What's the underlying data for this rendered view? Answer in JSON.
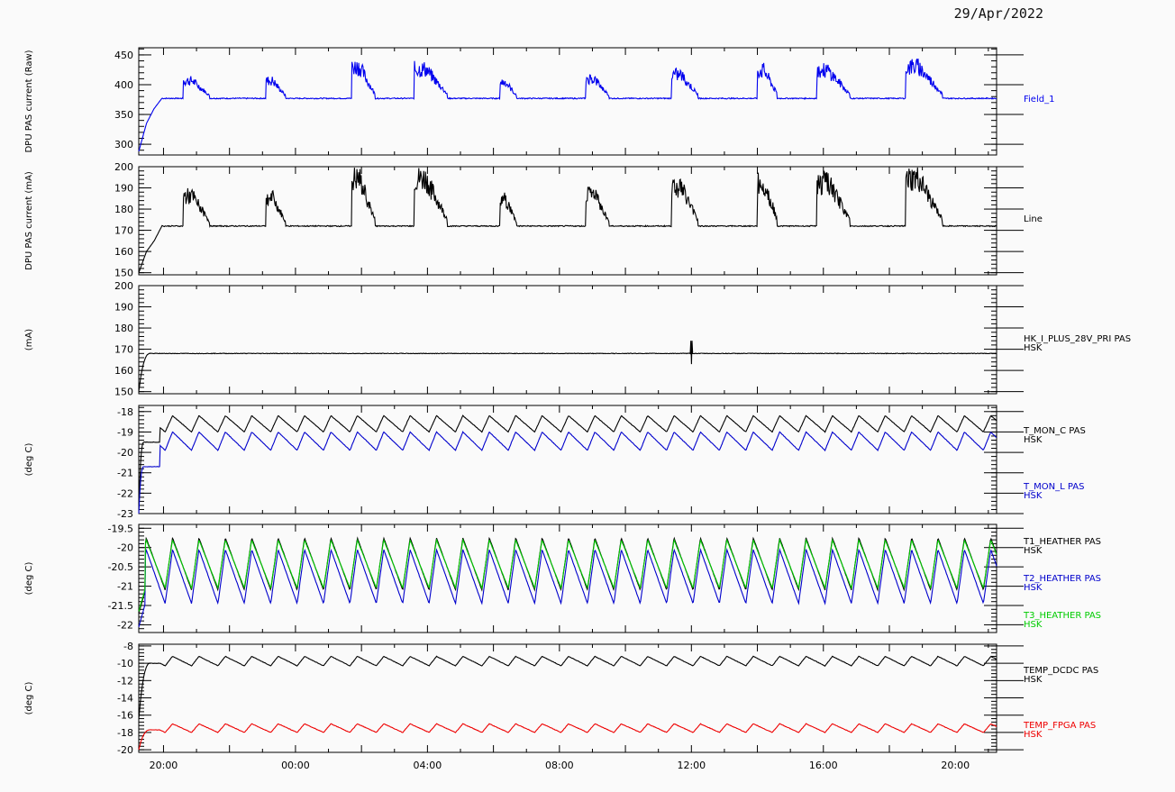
{
  "date_label": "29/Apr/2022",
  "time_axis": {
    "tick_labels": [
      "20:00",
      "00:00",
      "04:00",
      "08:00",
      "12:00",
      "16:00",
      "20:00"
    ],
    "tick_hours": [
      20,
      24,
      28,
      32,
      36,
      40,
      44
    ],
    "range_hours": [
      19.25,
      45.25
    ]
  },
  "chart_data": [
    {
      "type": "line",
      "ylabel": "DPU PAS current (Raw)",
      "ylim": [
        282,
        462
      ],
      "yticks": [
        300,
        350,
        400,
        450
      ],
      "baseline": 377,
      "start": [
        288,
        335,
        360,
        377
      ],
      "bursts": [
        [
          20.6,
          415,
          0.8
        ],
        [
          23.1,
          415,
          0.6
        ],
        [
          25.7,
          445,
          0.7
        ],
        [
          27.6,
          440,
          1.0
        ],
        [
          30.2,
          412,
          0.5
        ],
        [
          32.8,
          420,
          0.7
        ],
        [
          35.4,
          428,
          0.8
        ],
        [
          38.0,
          437,
          0.6
        ],
        [
          39.8,
          437,
          1.0
        ],
        [
          42.5,
          445,
          1.1
        ]
      ],
      "series": [
        {
          "name": "Field_1",
          "color": "#0000ee"
        }
      ],
      "legend": [
        {
          "lines": [
            "Field_1"
          ],
          "color": "#0000ee"
        }
      ]
    },
    {
      "type": "line",
      "ylabel": "DPU PAS current (mA)",
      "ylim": [
        149,
        200
      ],
      "yticks": [
        150,
        160,
        170,
        180,
        190,
        200
      ],
      "baseline": 172,
      "start": [
        150,
        160,
        165,
        172
      ],
      "bursts": [
        [
          20.6,
          190,
          0.8
        ],
        [
          23.1,
          189,
          0.6
        ],
        [
          25.7,
          200,
          0.7
        ],
        [
          27.6,
          200,
          1.0
        ],
        [
          30.2,
          188,
          0.5
        ],
        [
          32.8,
          192,
          0.7
        ],
        [
          35.4,
          196,
          0.8
        ],
        [
          38.0,
          198,
          0.6
        ],
        [
          39.8,
          198,
          1.0
        ],
        [
          42.5,
          200,
          1.1
        ]
      ],
      "series": [
        {
          "name": "Line",
          "color": "#000000"
        }
      ],
      "legend": [
        {
          "lines": [
            "Line"
          ],
          "color": "#000000"
        }
      ]
    },
    {
      "type": "line",
      "ylabel": "(mA)",
      "ylim": [
        149,
        200
      ],
      "yticks": [
        150,
        160,
        170,
        180,
        190,
        200
      ],
      "baseline": 168,
      "start": [
        150,
        165,
        168
      ],
      "spike_hour": 36.0,
      "series": [
        {
          "name": "HK_I_PLUS_28V_PRI PAS",
          "color": "#000000"
        }
      ],
      "legend": [
        {
          "lines": [
            "HK_I_PLUS_28V_PRI PAS",
            "HSK"
          ],
          "color": "#000000"
        }
      ]
    },
    {
      "type": "line",
      "ylabel": "(deg C)",
      "ylim": [
        -23,
        -17.7
      ],
      "yticks": [
        -23,
        -22,
        -21,
        -20,
        -19,
        -18
      ],
      "period_hours": 0.8,
      "series": [
        {
          "name": "T_MON_C PAS",
          "color": "#000000",
          "start": -22.8,
          "plateau": -19.5,
          "hi": -18.2,
          "lo": -19.0
        },
        {
          "name": "T_MON_L PAS",
          "color": "#0000cc",
          "start": -23.0,
          "plateau": -20.7,
          "hi": -19.0,
          "lo": -19.9
        }
      ],
      "legend": [
        {
          "lines": [
            "T_MON_C PAS",
            "HSK"
          ],
          "color": "#000000"
        },
        {
          "lines": [
            "T_MON_L PAS",
            "HSK"
          ],
          "color": "#0000cc"
        }
      ]
    },
    {
      "type": "line",
      "ylabel": "(deg C)",
      "ylim": [
        -22.2,
        -19.4
      ],
      "yticks": [
        -22.0,
        -21.5,
        -21.0,
        -20.5,
        -20.0,
        -19.5
      ],
      "period_hours": 0.8,
      "series": [
        {
          "name": "T1_HEATHER PAS",
          "color": "#000000",
          "hi": -19.75,
          "lo": -21.1
        },
        {
          "name": "T2_HEATHER PAS",
          "color": "#0000cc",
          "hi": -20.05,
          "lo": -21.45
        },
        {
          "name": "T3_HEATHER PAS",
          "color": "#00cc00",
          "hi": -19.8,
          "lo": -21.05
        }
      ],
      "legend": [
        {
          "lines": [
            "T1_HEATHER PAS",
            "HSK"
          ],
          "color": "#000000"
        },
        {
          "lines": [
            "T2_HEATHER PAS",
            "HSK"
          ],
          "color": "#0000cc"
        },
        {
          "lines": [
            "T3_HEATHER PAS",
            "HSK"
          ],
          "color": "#00cc00"
        }
      ]
    },
    {
      "type": "line",
      "ylabel": "(deg C)",
      "ylim": [
        -20.3,
        -7.8
      ],
      "yticks": [
        -20,
        -18,
        -16,
        -14,
        -12,
        -10,
        -8
      ],
      "period_hours": 0.8,
      "series": [
        {
          "name": "TEMP_DCDC PAS",
          "color": "#000000",
          "start": -16.5,
          "hi": -9.2,
          "lo": -10.3
        },
        {
          "name": "TEMP_FPGA PAS",
          "color": "#ee0000",
          "start": -20.0,
          "hi": -17.0,
          "lo": -18.0
        }
      ],
      "legend": [
        {
          "lines": [
            "TEMP_DCDC PAS",
            "HSK"
          ],
          "color": "#000000"
        },
        {
          "lines": [
            "TEMP_FPGA PAS",
            "HSK"
          ],
          "color": "#ee0000"
        }
      ]
    }
  ]
}
